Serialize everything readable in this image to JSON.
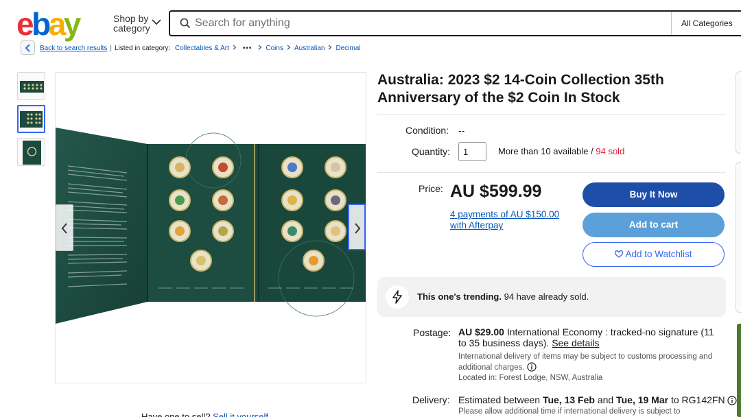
{
  "brand": {
    "logo_letters": [
      "e",
      "b",
      "a",
      "y"
    ],
    "logo_colors": [
      "#e53238",
      "#0064d2",
      "#f5af02",
      "#86b817"
    ]
  },
  "header": {
    "shop_by_line1": "Shop by",
    "shop_by_line2": "category",
    "search_placeholder": "Search for anything",
    "category_select": "All Categories"
  },
  "breadcrumb": {
    "back_label": "Back to search results",
    "listed_in": "Listed in category:",
    "items": [
      "Collectables & Art",
      "Coins",
      "Australian",
      "Decimal"
    ],
    "ellipsis": "•••"
  },
  "listing": {
    "title": "Australia: 2023 $2 14-Coin Collection 35th Anniversary of the $2 Coin In Stock",
    "condition_label": "Condition:",
    "condition_value": "--",
    "quantity_label": "Quantity:",
    "quantity_value": "1",
    "availability": "More than 10 available",
    "availability_sep": " / ",
    "sold": "94 sold",
    "price_label": "Price:",
    "price": "AU $599.99",
    "afterpay": "4 payments of AU $150.00 with Afterpay"
  },
  "actions": {
    "buy_now": "Buy It Now",
    "add_to_cart": "Add to cart",
    "add_to_watchlist": "Add to Watchlist"
  },
  "trending": {
    "bold": "This one's trending.",
    "text": " 94 have already sold."
  },
  "postage": {
    "label": "Postage:",
    "price": "AU $29.00",
    "service": " International Economy : tracked-no signature (11 to 35 business days).",
    "see_details": "See details",
    "customs_note": "International delivery of items may be subject to customs processing and additional charges.",
    "location": "Located in: Forest Lodge, NSW, Australia"
  },
  "delivery": {
    "label": "Delivery:",
    "prefix": "Estimated between ",
    "date1": "Tue, 13 Feb",
    "and": " and ",
    "date2": "Tue, 19 Mar",
    "suffix": " to RG142FN",
    "note": "Please allow additional time if international delivery is subject to"
  },
  "sell": {
    "text": "Have one to sell?",
    "link": "Sell it yourself"
  },
  "colors": {
    "accent_blue": "#3665f3",
    "buy_button": "#1f4ea8",
    "cart_button": "#5ba0d8",
    "sold_red": "#dd1e31",
    "folder_green": "#1c4a3e"
  }
}
